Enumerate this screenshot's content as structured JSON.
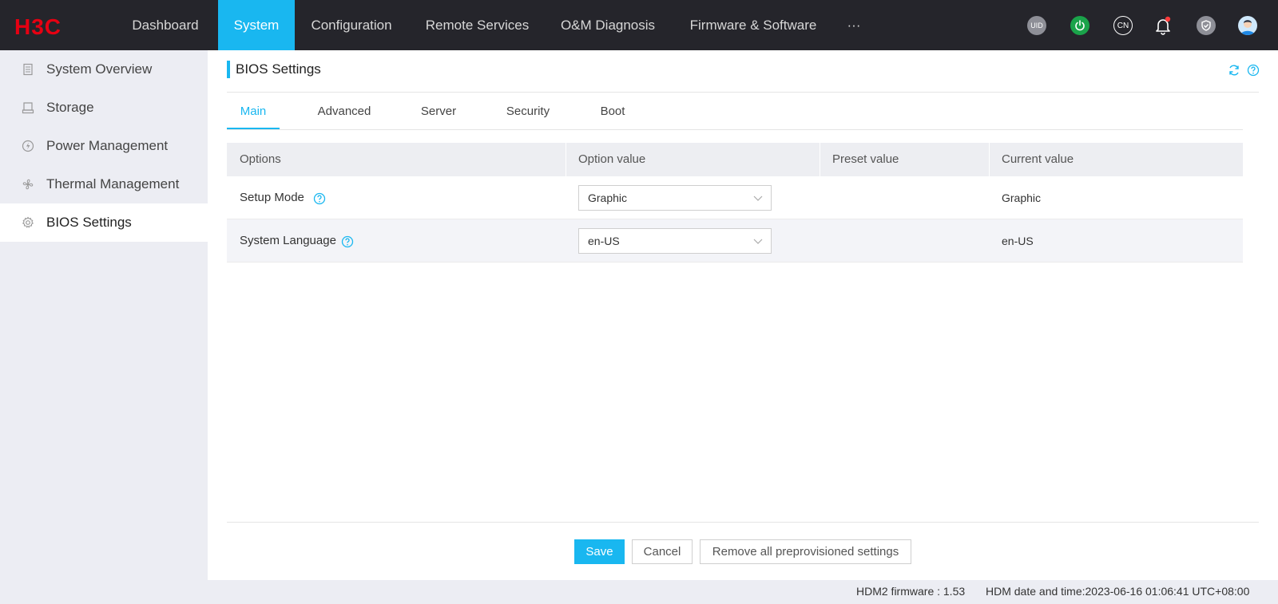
{
  "app": {
    "logo_text": "H3C"
  },
  "topnav": {
    "items": [
      {
        "label": "Dashboard"
      },
      {
        "label": "System"
      },
      {
        "label": "Configuration"
      },
      {
        "label": "Remote Services"
      },
      {
        "label": "O&M Diagnosis"
      },
      {
        "label": "Firmware & Software"
      },
      {
        "label": "···"
      }
    ],
    "active_index": 1,
    "icons": [
      {
        "name": "uid-icon",
        "text": "UID",
        "color": "#8e8f97"
      },
      {
        "name": "power-icon",
        "color": "#1aa34a"
      },
      {
        "name": "language-icon",
        "text": "CN"
      },
      {
        "name": "bell-icon",
        "badge_color": "#ff3a3a"
      },
      {
        "name": "shield-icon"
      },
      {
        "name": "user-avatar-icon"
      }
    ]
  },
  "sidebar": {
    "items": [
      {
        "label": "System Overview",
        "icon": "document-icon"
      },
      {
        "label": "Storage",
        "icon": "drive-icon"
      },
      {
        "label": "Power Management",
        "icon": "power-bolt-icon"
      },
      {
        "label": "Thermal Management",
        "icon": "fan-icon"
      },
      {
        "label": "BIOS Settings",
        "icon": "gear-icon"
      }
    ],
    "active_index": 4
  },
  "page": {
    "title": "BIOS Settings",
    "tabs": [
      {
        "label": "Main"
      },
      {
        "label": "Advanced"
      },
      {
        "label": "Server"
      },
      {
        "label": "Security"
      },
      {
        "label": "Boot"
      }
    ],
    "active_tab": 0
  },
  "table": {
    "headers": [
      "Options",
      "Option value",
      "Preset value",
      "Current value"
    ],
    "rows": [
      {
        "option": "Setup Mode",
        "option_value": "Graphic",
        "preset_value": "",
        "current_value": "Graphic"
      },
      {
        "option": "System Language",
        "option_value": "en-US",
        "preset_value": "",
        "current_value": "en-US"
      }
    ]
  },
  "actions": {
    "save": "Save",
    "cancel": "Cancel",
    "remove_all": "Remove all preprovisioned settings"
  },
  "status": {
    "firmware": "HDM2 firmware : 1.53",
    "datetime": "HDM date and time:2023-06-16 01:06:41 UTC+08:00"
  },
  "colors": {
    "accent": "#19b7f0",
    "topbar": "#25252b",
    "sidebar": "#ecedf3",
    "logo": "#e60012"
  }
}
